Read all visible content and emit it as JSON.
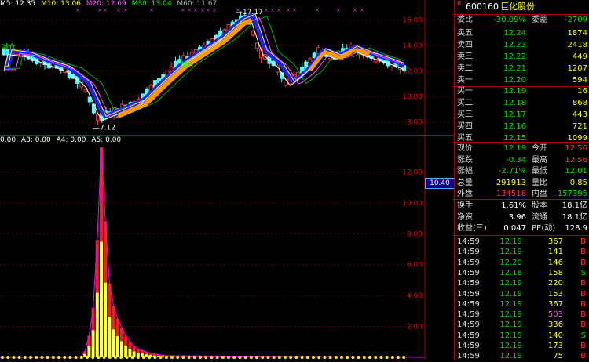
{
  "ma_legend": [
    {
      "label": "M5: 12.35",
      "color": "#ffffff"
    },
    {
      "label": "M10: 13.06",
      "color": "#ffff00"
    },
    {
      "label": "M20: 12.69",
      "color": "#ff55ff"
    },
    {
      "label": "M30: 13.04",
      "color": "#00ff00"
    },
    {
      "label": "M60: 11.67",
      "color": "#aaaaaa"
    }
  ],
  "indicator_legend": [
    "0.00",
    "A3: 0.00",
    "A4: 0.00",
    "A5: 0.00"
  ],
  "price_scale": [
    "16.00",
    "14.00",
    "12.00",
    "10.00",
    "8.00"
  ],
  "volume_scale": [
    "12.00",
    "10.00",
    "8.00",
    "6.00",
    "4.00",
    "2.00"
  ],
  "crosshair_value": "10.40",
  "annotations": {
    "high": "17.17",
    "low": "7.12",
    "flag1": "减仓",
    "flag2": "减仓"
  },
  "quote": {
    "marker": "R",
    "code": "600160",
    "name": "巨化股份",
    "weibi_label": "委比",
    "weibi": "-30.09%",
    "weicha_label": "委差",
    "weicha": "-2709",
    "asks": [
      {
        "label": "卖五",
        "price": "12.24",
        "vol": "1874"
      },
      {
        "label": "卖四",
        "price": "12.23",
        "vol": "2418"
      },
      {
        "label": "卖三",
        "price": "12.22",
        "vol": "449"
      },
      {
        "label": "卖二",
        "price": "12.21",
        "vol": "1207"
      },
      {
        "label": "卖一",
        "price": "12.20",
        "vol": "594"
      }
    ],
    "bids": [
      {
        "label": "买一",
        "price": "12.19",
        "vol": "16"
      },
      {
        "label": "买二",
        "price": "12.18",
        "vol": "868"
      },
      {
        "label": "买三",
        "price": "12.17",
        "vol": "443"
      },
      {
        "label": "买四",
        "price": "12.16",
        "vol": "721"
      },
      {
        "label": "买五",
        "price": "12.15",
        "vol": "1099"
      }
    ],
    "stats": [
      {
        "l1": "现价",
        "v1": "12.19",
        "c1": "green",
        "l2": "今开",
        "v2": "12.56",
        "c2": "red"
      },
      {
        "l1": "涨跌",
        "v1": "-0.34",
        "c1": "green",
        "l2": "最高",
        "v2": "12.56",
        "c2": "red"
      },
      {
        "l1": "涨幅",
        "v1": "-2.71%",
        "c1": "green",
        "l2": "最低",
        "v2": "12.01",
        "c2": "green"
      },
      {
        "l1": "总量",
        "v1": "291913",
        "c1": "yellow",
        "l2": "量比",
        "v2": "0.85",
        "c2": "yellow"
      },
      {
        "l1": "外盘",
        "v1": "134518",
        "c1": "red",
        "l2": "内盘",
        "v2": "157395",
        "c2": "green"
      }
    ],
    "fund": [
      {
        "l1": "换手",
        "v1": "1.61%",
        "l2": "股本",
        "v2": "18.1亿"
      },
      {
        "l1": "净资",
        "v1": "3.96",
        "l2": "流通",
        "v2": "18.1亿"
      },
      {
        "l1": "收益(三)",
        "v1": "0.047",
        "l2": "PE(动)",
        "v2": "128.9"
      }
    ],
    "ticks": [
      {
        "time": "14:59",
        "price": "12.19",
        "vol": "367",
        "side": "B"
      },
      {
        "time": "14:59",
        "price": "12.19",
        "vol": "141",
        "side": "B"
      },
      {
        "time": "14:59",
        "price": "12.20",
        "vol": "146",
        "side": "B"
      },
      {
        "time": "14:59",
        "price": "12.18",
        "vol": "158",
        "side": "S"
      },
      {
        "time": "14:59",
        "price": "12.19",
        "vol": "220",
        "side": "B"
      },
      {
        "time": "14:59",
        "price": "12.19",
        "vol": "153",
        "side": "B"
      },
      {
        "time": "14:59",
        "price": "12.19",
        "vol": "367",
        "side": "B"
      },
      {
        "time": "14:59",
        "price": "12.19",
        "vol": "503",
        "side": "B"
      },
      {
        "time": "14:59",
        "price": "12.19",
        "vol": "336",
        "side": "B"
      },
      {
        "time": "14:59",
        "price": "12.19",
        "vol": "140",
        "side": "S"
      },
      {
        "time": "14:59",
        "price": "12.19",
        "vol": "173",
        "side": "B"
      },
      {
        "time": "14:59",
        "price": "12.19",
        "vol": "75",
        "side": "B"
      }
    ]
  }
}
